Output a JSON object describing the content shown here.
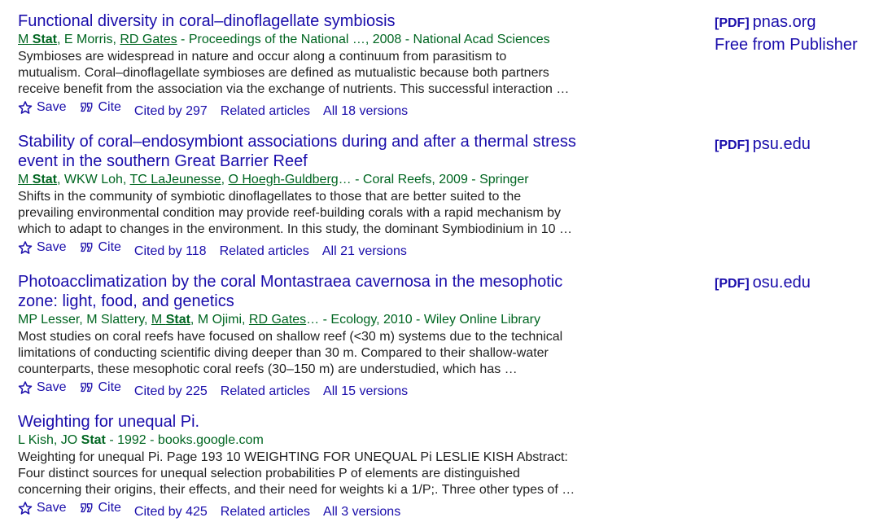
{
  "results": [
    {
      "title_lines": [
        "Functional diversity in coral–dinoflagellate symbiosis"
      ],
      "meta": {
        "authors": [
          {
            "prefix": "",
            "name": "M ",
            "bold": "Stat",
            "linked": true
          },
          {
            "prefix": ", ",
            "name": "E Morris",
            "bold": "",
            "linked": false
          },
          {
            "prefix": ", ",
            "name": "RD Gates",
            "bold": "",
            "linked": true
          }
        ],
        "source": " - Proceedings of the National …, 2008 - National Acad Sciences"
      },
      "snippet_lines": [
        "Symbioses are widespread in nature and occur along a continuum from parasitism to",
        "mutualism. Coral–dinoflagellate symbioses are defined as mutualistic because both partners",
        "receive benefit from the association via the exchange of nutrients. This successful interaction …"
      ],
      "actions": {
        "save": "Save",
        "cite": "Cite",
        "cited_by": "Cited by 297",
        "related": "Related articles",
        "versions": "All 18 versions"
      },
      "side": {
        "tag": "[PDF]",
        "domain": "pnas.org",
        "extra": "Free from Publisher"
      }
    },
    {
      "title_lines": [
        "Stability of coral–endosymbiont associations during and after a thermal stress",
        "event in the southern Great Barrier Reef"
      ],
      "meta": {
        "authors": [
          {
            "prefix": "",
            "name": "M ",
            "bold": "Stat",
            "linked": true
          },
          {
            "prefix": ", ",
            "name": "WKW Loh",
            "bold": "",
            "linked": false
          },
          {
            "prefix": ", ",
            "name": "TC LaJeunesse",
            "bold": "",
            "linked": true
          },
          {
            "prefix": ", ",
            "name": "O Hoegh-Guldberg",
            "bold": "",
            "linked": true
          }
        ],
        "source": "… - Coral Reefs, 2009 - Springer"
      },
      "snippet_lines": [
        "Shifts in the community of symbiotic dinoflagellates to those that are better suited to the",
        "prevailing environmental condition may provide reef-building corals with a rapid mechanism by",
        "which to adapt to changes in the environment. In this study, the dominant Symbiodinium in 10 …"
      ],
      "actions": {
        "save": "Save",
        "cite": "Cite",
        "cited_by": "Cited by 118",
        "related": "Related articles",
        "versions": "All 21 versions"
      },
      "side": {
        "tag": "[PDF]",
        "domain": "psu.edu",
        "extra": ""
      }
    },
    {
      "title_lines": [
        "Photoacclimatization by the coral Montastraea cavernosa in the mesophotic",
        "zone: light, food, and genetics"
      ],
      "meta": {
        "authors": [
          {
            "prefix": "",
            "name": "MP Lesser",
            "bold": "",
            "linked": false
          },
          {
            "prefix": ", ",
            "name": "M Slattery",
            "bold": "",
            "linked": false
          },
          {
            "prefix": ", ",
            "name": "M ",
            "bold": "Stat",
            "linked": true
          },
          {
            "prefix": ", ",
            "name": "M Ojimi",
            "bold": "",
            "linked": false
          },
          {
            "prefix": ", ",
            "name": "RD Gates",
            "bold": "",
            "linked": true
          }
        ],
        "source": "… - Ecology, 2010 - Wiley Online Library"
      },
      "snippet_lines": [
        "Most studies on coral reefs have focused on shallow reef (<30 m) systems due to the technical",
        "limitations of conducting scientific diving deeper than 30 m. Compared to their shallow-water",
        "counterparts, these mesophotic coral reefs (30–150 m) are understudied, which has …"
      ],
      "actions": {
        "save": "Save",
        "cite": "Cite",
        "cited_by": "Cited by 225",
        "related": "Related articles",
        "versions": "All 15 versions"
      },
      "side": {
        "tag": "[PDF]",
        "domain": "osu.edu",
        "extra": ""
      }
    },
    {
      "title_lines": [
        "Weighting for unequal Pi."
      ],
      "meta": {
        "authors": [
          {
            "prefix": "",
            "name": "L Kish",
            "bold": "",
            "linked": false
          },
          {
            "prefix": ", ",
            "name": "JO ",
            "bold": "Stat",
            "linked": false
          }
        ],
        "source": " - 1992 - books.google.com"
      },
      "snippet_lines": [
        "Weighting for unequal Pi. Page 193 10 WEIGHTING FOR UNEQUAL Pi LESLIE KISH Abstract:",
        "Four distinct sources for unequal selection probabilities P of elements are distinguished",
        "concerning their origins, their effects, and their need for weights ki a 1/P;. Three other types of …"
      ],
      "actions": {
        "save": "Save",
        "cite": "Cite",
        "cited_by": "Cited by 425",
        "related": "Related articles",
        "versions": "All 3 versions"
      },
      "side": null
    }
  ]
}
